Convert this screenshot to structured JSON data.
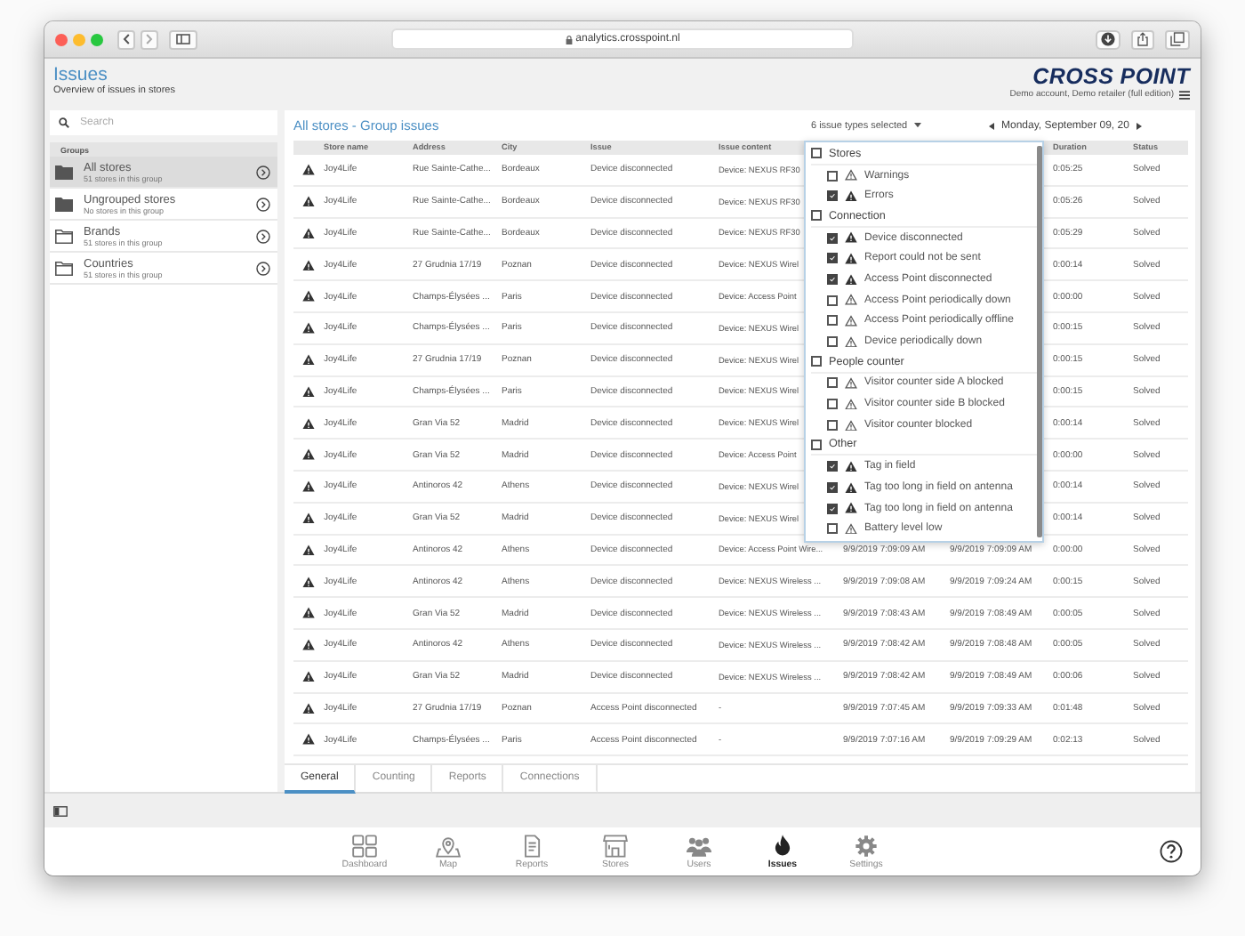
{
  "browser": {
    "url": "analytics.crosspoint.nl"
  },
  "header": {
    "title": "Issues",
    "subtitle": "Overview of issues in stores",
    "logo": "CROSS POINT",
    "account": "Demo account, Demo retailer (full edition)"
  },
  "sidebar": {
    "search": {
      "placeholder": "Search"
    },
    "groups_label": "Groups",
    "items": [
      {
        "name": "All stores",
        "count": "51 stores in this group",
        "kind": "filled",
        "selected": true
      },
      {
        "name": "Ungrouped stores",
        "count": "No stores in this group",
        "kind": "filled",
        "selected": false
      },
      {
        "name": "Brands",
        "count": "51 stores in this group",
        "kind": "outline",
        "selected": false
      },
      {
        "name": "Countries",
        "count": "51 stores in this group",
        "kind": "outline",
        "selected": false
      }
    ]
  },
  "panel": {
    "title": "All stores - Group issues",
    "filter_label": "6 issue types selected",
    "date": "Monday, September 09, 20"
  },
  "table": {
    "columns": [
      "Store name",
      "Address",
      "City",
      "Issue",
      "Issue content",
      "Duration",
      "Status"
    ],
    "rows": [
      {
        "store": "Joy4Life",
        "address": "Rue Sainte-Cathe...",
        "city": "Bordeaux",
        "issue": "Device disconnected",
        "content": "Device: NEXUS RF30",
        "duration": "0:05:25",
        "status": "Solved"
      },
      {
        "store": "Joy4Life",
        "address": "Rue Sainte-Cathe...",
        "city": "Bordeaux",
        "issue": "Device disconnected",
        "content": "Device: NEXUS RF30",
        "duration": "0:05:26",
        "status": "Solved"
      },
      {
        "store": "Joy4Life",
        "address": "Rue Sainte-Cathe...",
        "city": "Bordeaux",
        "issue": "Device disconnected",
        "content": "Device: NEXUS RF30",
        "duration": "0:05:29",
        "status": "Solved"
      },
      {
        "store": "Joy4Life",
        "address": "27 Grudnia 17/19",
        "city": "Poznan",
        "issue": "Device disconnected",
        "content": "Device: NEXUS Wirel",
        "duration": "0:00:14",
        "status": "Solved"
      },
      {
        "store": "Joy4Life",
        "address": "Champs-Élysées ...",
        "city": "Paris",
        "issue": "Device disconnected",
        "content": "Device: Access Point",
        "duration": "0:00:00",
        "status": "Solved"
      },
      {
        "store": "Joy4Life",
        "address": "Champs-Élysées ...",
        "city": "Paris",
        "issue": "Device disconnected",
        "content": "Device: NEXUS Wirel",
        "duration": "0:00:15",
        "status": "Solved"
      },
      {
        "store": "Joy4Life",
        "address": "27 Grudnia 17/19",
        "city": "Poznan",
        "issue": "Device disconnected",
        "content": "Device: NEXUS Wirel",
        "duration": "0:00:15",
        "status": "Solved"
      },
      {
        "store": "Joy4Life",
        "address": "Champs-Élysées ...",
        "city": "Paris",
        "issue": "Device disconnected",
        "content": "Device: NEXUS Wirel",
        "duration": "0:00:15",
        "status": "Solved"
      },
      {
        "store": "Joy4Life",
        "address": "Gran Via 52",
        "city": "Madrid",
        "issue": "Device disconnected",
        "content": "Device: NEXUS Wirel",
        "duration": "0:00:14",
        "status": "Solved"
      },
      {
        "store": "Joy4Life",
        "address": "Gran Via 52",
        "city": "Madrid",
        "issue": "Device disconnected",
        "content": "Device: Access Point",
        "duration": "0:00:00",
        "status": "Solved"
      },
      {
        "store": "Joy4Life",
        "address": "Antinoros 42",
        "city": "Athens",
        "issue": "Device disconnected",
        "content": "Device: NEXUS Wirel",
        "duration": "0:00:14",
        "status": "Solved"
      },
      {
        "store": "Joy4Life",
        "address": "Gran Via 52",
        "city": "Madrid",
        "issue": "Device disconnected",
        "content": "Device: NEXUS Wirel",
        "duration": "0:00:14",
        "status": "Solved"
      },
      {
        "store": "Joy4Life",
        "address": "Antinoros 42",
        "city": "Athens",
        "issue": "Device disconnected",
        "content": "Device: Access Point Wire...",
        "start": "9/9/2019 7:09:09 AM",
        "end": "9/9/2019 7:09:09 AM",
        "duration": "0:00:00",
        "status": "Solved"
      },
      {
        "store": "Joy4Life",
        "address": "Antinoros 42",
        "city": "Athens",
        "issue": "Device disconnected",
        "content": "Device: NEXUS Wireless ...",
        "start": "9/9/2019 7:09:08 AM",
        "end": "9/9/2019 7:09:24 AM",
        "duration": "0:00:15",
        "status": "Solved"
      },
      {
        "store": "Joy4Life",
        "address": "Gran Via 52",
        "city": "Madrid",
        "issue": "Device disconnected",
        "content": "Device: NEXUS Wireless ...",
        "start": "9/9/2019 7:08:43 AM",
        "end": "9/9/2019 7:08:49 AM",
        "duration": "0:00:05",
        "status": "Solved"
      },
      {
        "store": "Joy4Life",
        "address": "Antinoros 42",
        "city": "Athens",
        "issue": "Device disconnected",
        "content": "Device: NEXUS Wireless ...",
        "start": "9/9/2019 7:08:42 AM",
        "end": "9/9/2019 7:08:48 AM",
        "duration": "0:00:05",
        "status": "Solved"
      },
      {
        "store": "Joy4Life",
        "address": "Gran Via 52",
        "city": "Madrid",
        "issue": "Device disconnected",
        "content": "Device: NEXUS Wireless ...",
        "start": "9/9/2019 7:08:42 AM",
        "end": "9/9/2019 7:08:49 AM",
        "duration": "0:00:06",
        "status": "Solved"
      },
      {
        "store": "Joy4Life",
        "address": "27 Grudnia 17/19",
        "city": "Poznan",
        "issue": "Access Point disconnected",
        "content": "-",
        "start": "9/9/2019 7:07:45 AM",
        "end": "9/9/2019 7:09:33 AM",
        "duration": "0:01:48",
        "status": "Solved"
      },
      {
        "store": "Joy4Life",
        "address": "Champs-Élysées ...",
        "city": "Paris",
        "issue": "Access Point disconnected",
        "content": "-",
        "start": "9/9/2019 7:07:16 AM",
        "end": "9/9/2019 7:09:29 AM",
        "duration": "0:02:13",
        "status": "Solved"
      }
    ]
  },
  "filter": {
    "groups": [
      {
        "label": "Stores",
        "checked": false,
        "children": [
          {
            "label": "Warnings",
            "checked": false
          },
          {
            "label": "Errors",
            "checked": true
          }
        ]
      },
      {
        "label": "Connection",
        "checked": false,
        "children": [
          {
            "label": "Device disconnected",
            "checked": true
          },
          {
            "label": "Report could not be sent",
            "checked": true
          },
          {
            "label": "Access Point disconnected",
            "checked": true
          },
          {
            "label": "Access Point periodically down",
            "checked": false
          },
          {
            "label": "Access Point periodically offline",
            "checked": false
          },
          {
            "label": "Device periodically down",
            "checked": false
          }
        ]
      },
      {
        "label": "People counter",
        "checked": false,
        "children": [
          {
            "label": "Visitor counter side A blocked",
            "checked": false
          },
          {
            "label": "Visitor counter side B blocked",
            "checked": false
          },
          {
            "label": "Visitor counter blocked",
            "checked": false
          }
        ]
      },
      {
        "label": "Other",
        "checked": false,
        "children": [
          {
            "label": "Tag in field",
            "checked": true
          },
          {
            "label": "Tag too long in field on antenna",
            "checked": true
          },
          {
            "label": "Tag too long in field on antenna",
            "checked": true
          },
          {
            "label": "Battery level low",
            "checked": false
          }
        ]
      }
    ]
  },
  "tabs": [
    {
      "label": "General",
      "selected": true
    },
    {
      "label": "Counting",
      "selected": false
    },
    {
      "label": "Reports",
      "selected": false
    },
    {
      "label": "Connections",
      "selected": false
    }
  ],
  "bottom_nav": [
    {
      "label": "Dashboard",
      "selected": false
    },
    {
      "label": "Map",
      "selected": false
    },
    {
      "label": "Reports",
      "selected": false
    },
    {
      "label": "Stores",
      "selected": false
    },
    {
      "label": "Users",
      "selected": false
    },
    {
      "label": "Issues",
      "selected": true
    },
    {
      "label": "Settings",
      "selected": false
    }
  ]
}
